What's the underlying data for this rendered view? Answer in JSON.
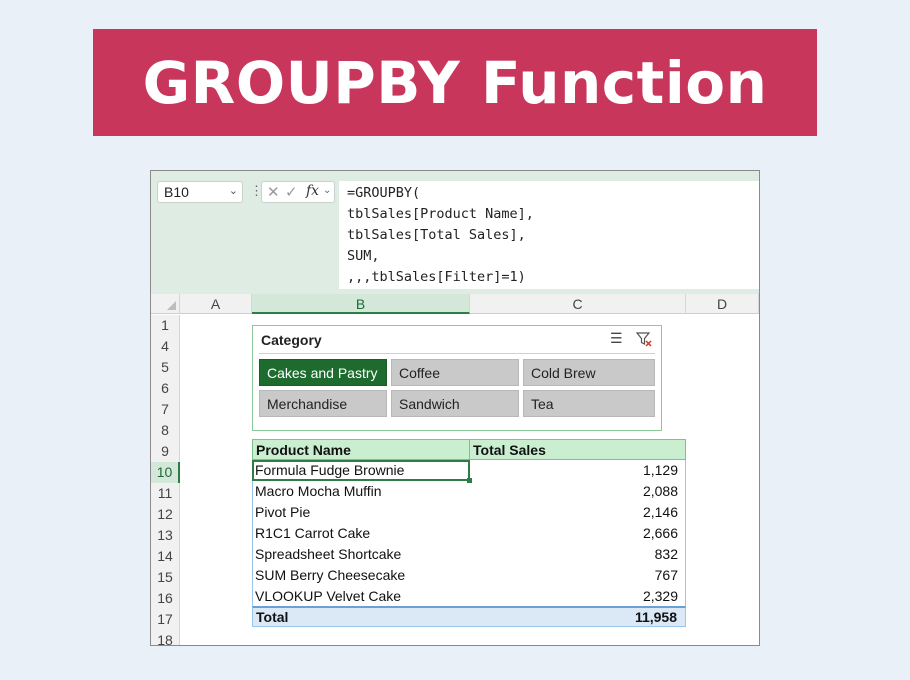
{
  "banner": {
    "title": "GROUPBY Function"
  },
  "formula_bar": {
    "name_box": "B10",
    "fx_label": "fx",
    "formula_lines": [
      "=GROUPBY(",
      "tblSales[Product Name],",
      "tblSales[Total Sales],",
      "SUM,",
      ",,,tblSales[Filter]=1)"
    ]
  },
  "columns": [
    "A",
    "B",
    "C",
    "D"
  ],
  "rows": [
    "1",
    "4",
    "5",
    "6",
    "7",
    "8",
    "9",
    "10",
    "11",
    "12",
    "13",
    "14",
    "15",
    "16",
    "17",
    "18"
  ],
  "selected_row": "10",
  "slicer": {
    "title": "Category",
    "items": [
      {
        "label": "Cakes and Pastry",
        "active": true
      },
      {
        "label": "Coffee",
        "active": false
      },
      {
        "label": "Cold Brew",
        "active": false
      },
      {
        "label": "Merchandise",
        "active": false
      },
      {
        "label": "Sandwich",
        "active": false
      },
      {
        "label": "Tea",
        "active": false
      }
    ]
  },
  "table": {
    "headers": [
      "Product Name",
      "Total Sales"
    ],
    "rows": [
      {
        "name": "Formula Fudge Brownie",
        "value": "1,129"
      },
      {
        "name": "Macro Mocha Muffin",
        "value": "2,088"
      },
      {
        "name": "Pivot Pie",
        "value": "2,146"
      },
      {
        "name": "R1C1 Carrot Cake",
        "value": "2,666"
      },
      {
        "name": "Spreadsheet Shortcake",
        "value": "832"
      },
      {
        "name": "SUM Berry Cheesecake",
        "value": "767"
      },
      {
        "name": "VLOOKUP Velvet Cake",
        "value": "2,329"
      }
    ],
    "total": {
      "label": "Total",
      "value": "11,958"
    }
  },
  "colors": {
    "banner": "#c8365c",
    "excel_green": "#1e6b2e",
    "table_header": "#c9efd0",
    "total_row": "#dbe9f7"
  }
}
